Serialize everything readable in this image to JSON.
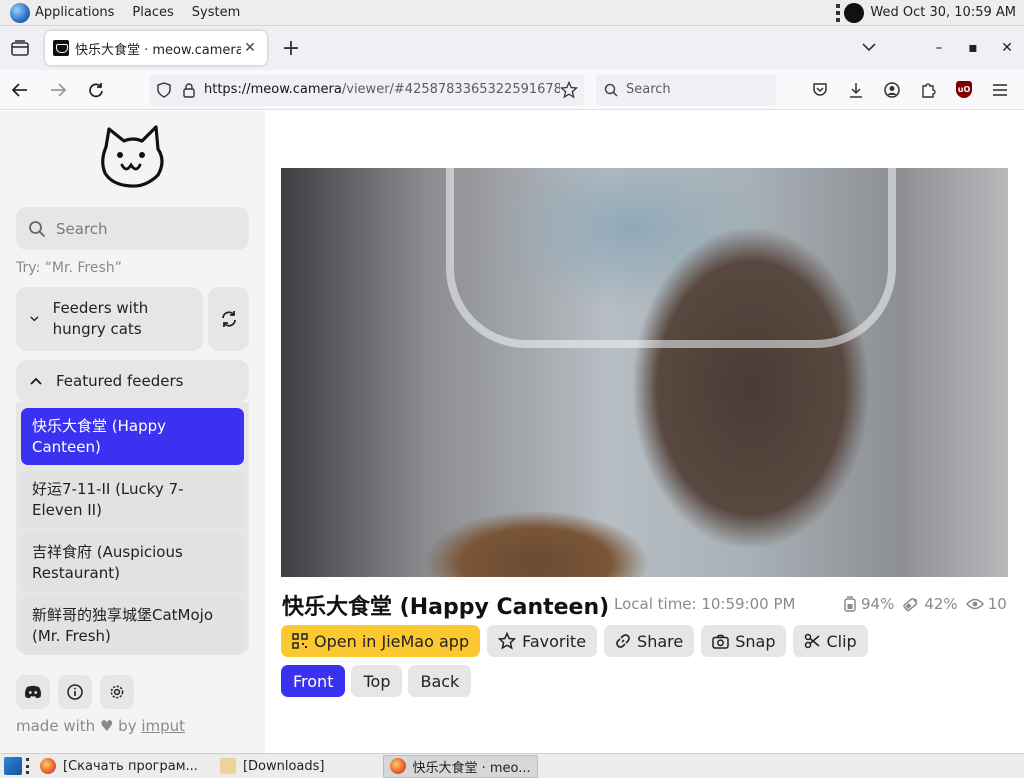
{
  "desktop": {
    "menus": [
      "Applications",
      "Places",
      "System"
    ],
    "clock": "Wed Oct 30, 10:59 AM"
  },
  "browser": {
    "tab_title": "快乐大食堂 · meow.camera",
    "url_host": "https://meow.camera",
    "url_path": "/viewer/#4258783365322591678",
    "search_placeholder": "Search"
  },
  "sidebar": {
    "search_placeholder": "Search",
    "hint": "Try: “Mr. Fresh”",
    "hungry_section": "Feeders with hungry cats",
    "featured_section": "Featured feeders",
    "feeders": [
      {
        "label": "快乐大食堂 (Happy Canteen)",
        "selected": true
      },
      {
        "label": "好运7-11-II (Lucky 7-Eleven II)",
        "selected": false
      },
      {
        "label": "吉祥食府 (Auspicious Restaurant)",
        "selected": false
      },
      {
        "label": "新鲜哥的独享城堡CatMojo (Mr. Fresh)",
        "selected": false
      }
    ],
    "made_with_prefix": "made with",
    "made_with_by": "by",
    "made_with_link": "imput"
  },
  "camera": {
    "title": "快乐大食堂 (Happy Canteen)",
    "local_time": "Local time: 10:59:00 PM",
    "stats": {
      "food": "94%",
      "battery": "42%",
      "viewers": "10"
    },
    "actions": [
      "Open in JieMao app",
      "Favorite",
      "Share",
      "Snap",
      "Clip"
    ],
    "views": [
      {
        "label": "Front",
        "selected": true
      },
      {
        "label": "Top",
        "selected": false
      },
      {
        "label": "Back",
        "selected": false
      }
    ]
  },
  "taskbar": {
    "tasks": [
      "[Скачать програм...",
      "[Downloads]",
      "快乐大食堂 · meo..."
    ]
  },
  "colors": {
    "accent": "#3b32f1",
    "jiemao_button": "#fbc82f"
  }
}
